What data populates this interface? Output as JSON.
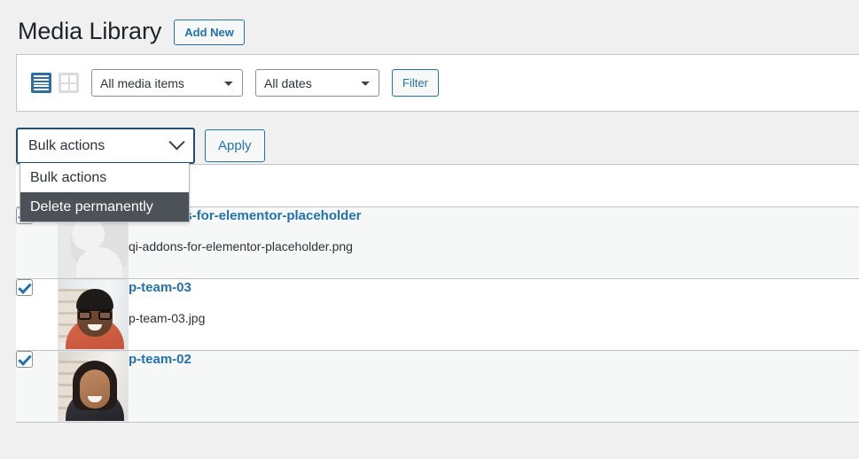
{
  "header": {
    "title": "Media Library",
    "add_new_label": "Add New"
  },
  "toolbar": {
    "view_list_icon": "list-view-icon",
    "view_grid_icon": "grid-view-icon",
    "media_filter": {
      "selected": "All media items",
      "options": [
        "All media items"
      ]
    },
    "date_filter": {
      "selected": "All dates",
      "options": [
        "All dates"
      ]
    },
    "filter_button": "Filter"
  },
  "bulk": {
    "selected": "Bulk actions",
    "apply_label": "Apply",
    "dropdown_open": true,
    "options": [
      {
        "label": "Bulk actions",
        "highlighted": false
      },
      {
        "label": "Delete permanently",
        "highlighted": true
      }
    ]
  },
  "table": {
    "columns": [
      "",
      "",
      ""
    ],
    "rows": [
      {
        "checked": true,
        "thumb": "placeholder-avatar",
        "title": "qi-addons-for-elementor-placeholder",
        "filename": "qi-addons-for-elementor-placeholder.png"
      },
      {
        "checked": true,
        "thumb": "portrait-man-glasses",
        "title": "p-team-03",
        "filename": "p-team-03.jpg"
      },
      {
        "checked": true,
        "thumb": "portrait-woman",
        "title": "p-team-02",
        "filename": ""
      }
    ]
  },
  "colors": {
    "accent_blue": "#2271b1",
    "focus_blue": "#1d4e78",
    "highlight_gray": "#4c5258",
    "page_bg": "#f0f0f1"
  }
}
